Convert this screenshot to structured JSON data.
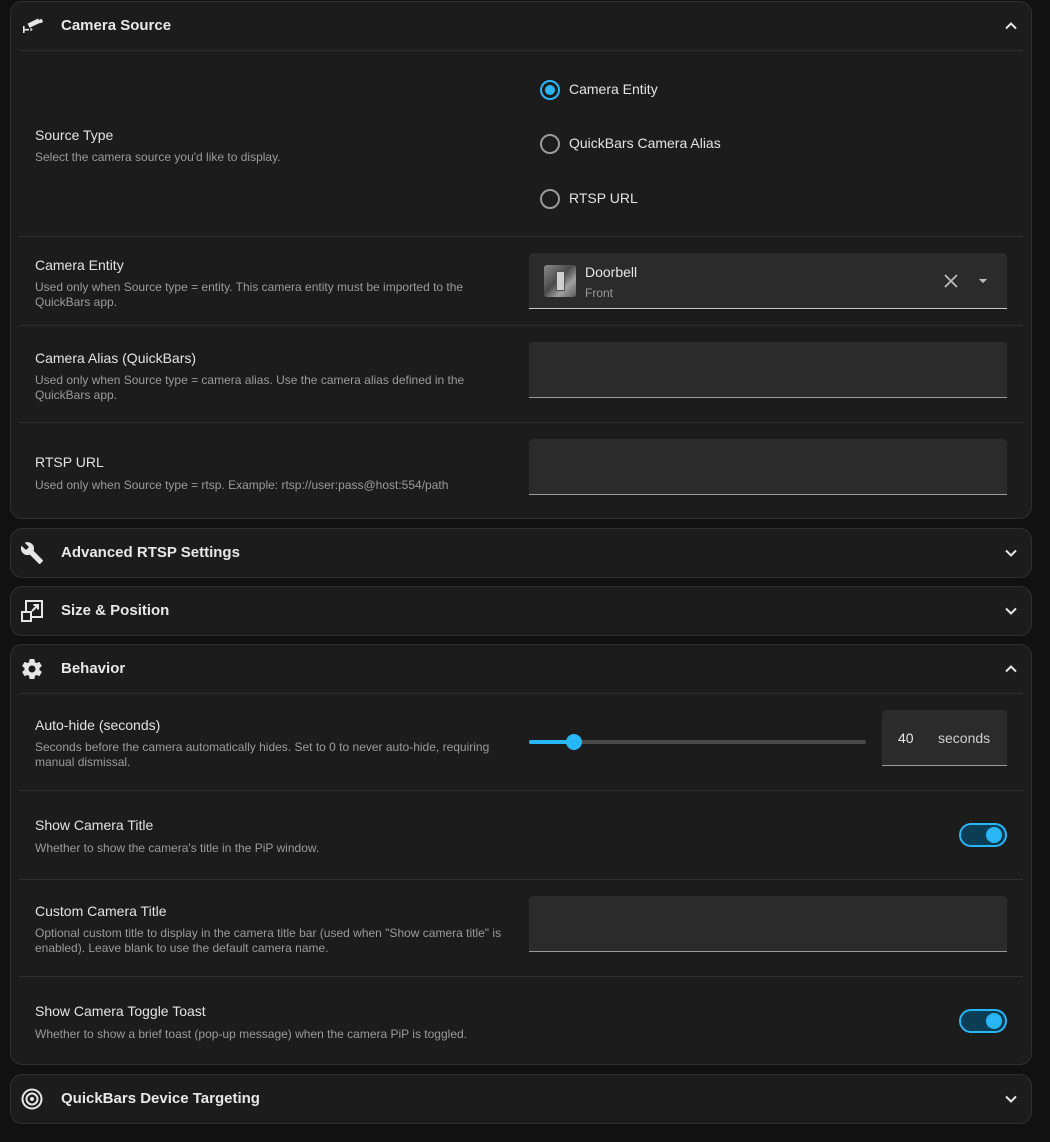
{
  "camera_source": {
    "title": "Camera Source",
    "source_type": {
      "label": "Source Type",
      "description": "Select the camera source you'd like to display.",
      "options": [
        "Camera Entity",
        "QuickBars Camera Alias",
        "RTSP URL"
      ],
      "selected": "Camera Entity"
    },
    "camera_entity": {
      "label": "Camera Entity",
      "description": "Used only when Source type = entity. This camera entity must be imported to the QuickBars app.",
      "value_name": "Doorbell",
      "value_sub": "Front"
    },
    "camera_alias": {
      "label": "Camera Alias (QuickBars)",
      "description": "Used only when Source type = camera alias. Use the camera alias defined in the QuickBars app.",
      "value": ""
    },
    "rtsp_url": {
      "label": "RTSP URL",
      "description": "Used only when Source type = rtsp. Example: rtsp://user:pass@host:554/path",
      "value": ""
    }
  },
  "advanced_rtsp": {
    "title": "Advanced RTSP Settings"
  },
  "size_position": {
    "title": "Size & Position"
  },
  "behavior": {
    "title": "Behavior",
    "auto_hide": {
      "label": "Auto-hide (seconds)",
      "description": "Seconds before the camera automatically hides. Set to 0 to never auto-hide, requiring manual dismissal.",
      "value": "40",
      "unit": "seconds",
      "slider_fraction": 0.13
    },
    "show_title": {
      "label": "Show Camera Title",
      "description": "Whether to show the camera's title in the PiP window.",
      "on": true
    },
    "custom_title": {
      "label": "Custom Camera Title",
      "description": "Optional custom title to display in the camera title bar (used when \"Show camera title\" is enabled). Leave blank to use the default camera name.",
      "value": ""
    },
    "toggle_toast": {
      "label": "Show Camera Toggle Toast",
      "description": "Whether to show a brief toast (pop-up message) when the camera PiP is toggled.",
      "on": true
    }
  },
  "device_targeting": {
    "title": "QuickBars Device Targeting"
  },
  "colors": {
    "accent": "#29b6f6",
    "panel": "#1c1c1c",
    "background": "#111111"
  }
}
